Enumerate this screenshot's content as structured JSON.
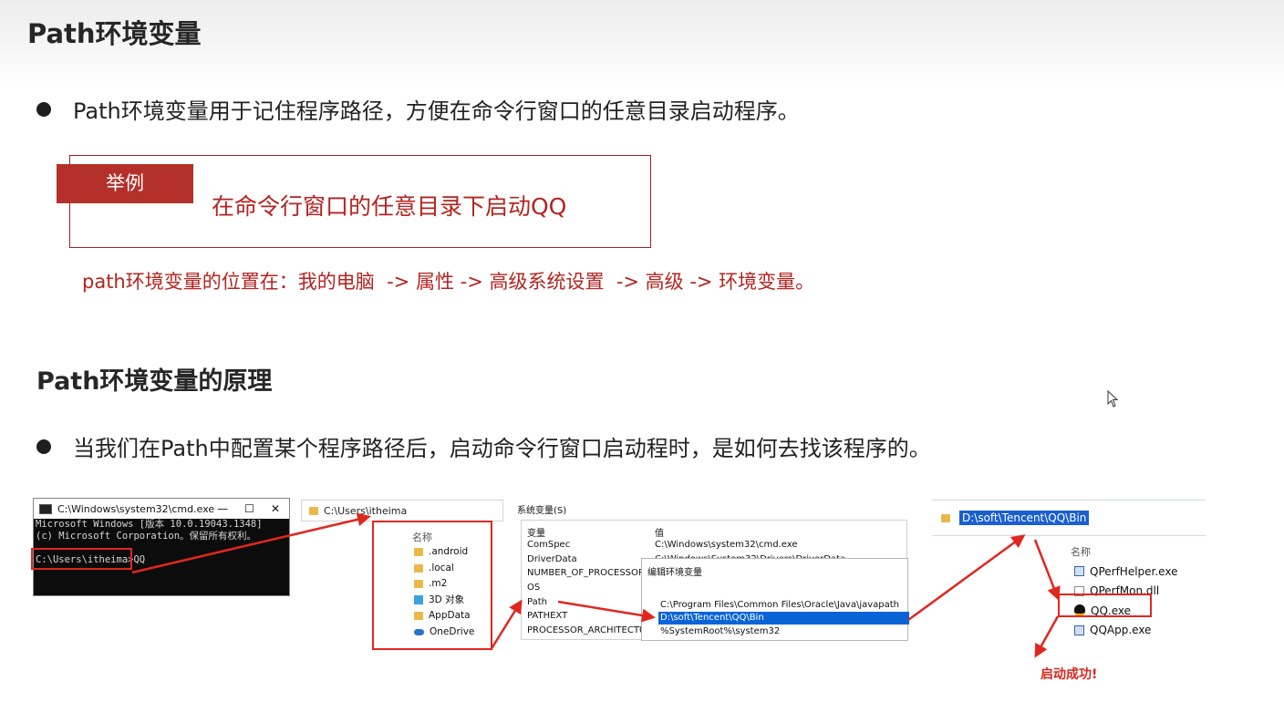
{
  "section1": {
    "title": "Path环境变量",
    "bullet": "Path环境变量用于记住程序路径，方便在命令行窗口的任意目录启动程序。",
    "example_tag": "举例",
    "example_text": "在命令行窗口的任意目录下启动QQ",
    "location_note": "path环境变量的位置在：我的电脑  -> 属性 -> 高级系统设置  -> 高级 -> 环境变量。"
  },
  "section2": {
    "title": "Path环境变量的原理",
    "bullet": "当我们在Path中配置某个程序路径后，启动命令行窗口启动程时，是如何去找该程序的。"
  },
  "cmd": {
    "title": "C:\\Windows\\system32\\cmd.exe",
    "controls": [
      "—",
      "☐",
      "✕"
    ],
    "lines": [
      "Microsoft Windows [版本 10.0.19043.1348]",
      "(c) Microsoft Corporation。保留所有权利。",
      "",
      "C:\\Users\\itheima>QQ"
    ]
  },
  "explorer": {
    "address": "C:\\Users\\itheima",
    "header": "名称",
    "items": [
      ".android",
      ".local",
      ".m2",
      "3D 对象",
      "AppData",
      "OneDrive"
    ]
  },
  "system_vars": {
    "title": "系统变量(S)",
    "col_var": "变量",
    "col_val": "值",
    "rows": [
      "ComSpec",
      "DriverData",
      "NUMBER_OF_PROCESSORS",
      "OS",
      "Path",
      "PATHEXT",
      "PROCESSOR_ARCHITECTURE"
    ],
    "values": [
      "C:\\Windows\\system32\\cmd.exe",
      "C:\\Windows\\System32\\Drivers\\DriverData"
    ]
  },
  "edit_env": {
    "title": "编辑环境变量",
    "lines": [
      "C:\\Program Files\\Common Files\\Oracle\\Java\\javapath",
      "D:\\soft\\Tencent\\QQ\\Bin",
      "%SystemRoot%\\system32"
    ]
  },
  "qq_folder": {
    "address": "D:\\soft\\Tencent\\QQ\\Bin",
    "header": "名称",
    "items": [
      "QPerfHelper.exe",
      "QPerfMon.dll",
      "QQ.exe",
      "QQApp.exe"
    ]
  },
  "success_text": "启动成功!",
  "colors": {
    "accent_red": "#b5231f",
    "tag_bg": "#b4302a",
    "arrow_red": "#e0271f",
    "selection_blue": "#0a64d8"
  }
}
